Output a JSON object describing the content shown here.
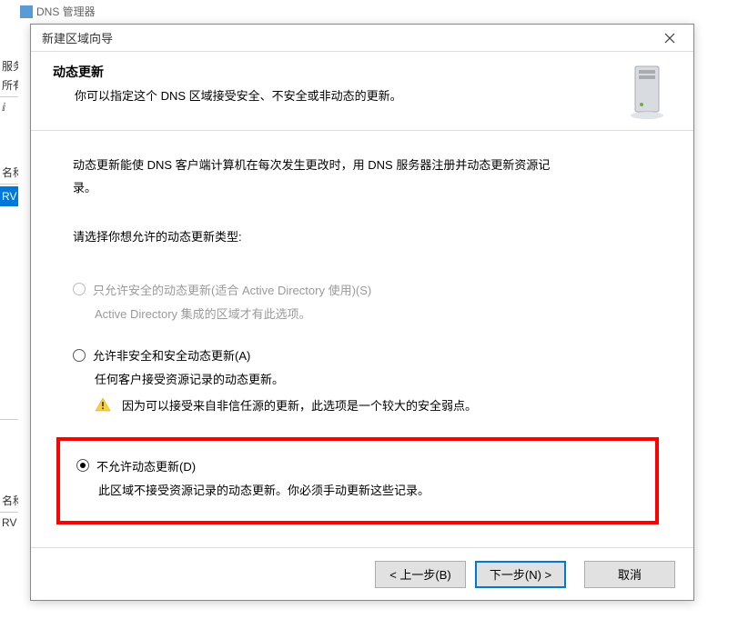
{
  "background": {
    "window_title": "DNS 管理器",
    "sidebar": {
      "item1": "服务",
      "item2": "所有",
      "itemE": "ⅈ",
      "itemName": "名称",
      "itemActive": "RV",
      "itemBottom1": "名称",
      "itemBottom2": "RV"
    }
  },
  "dialog": {
    "title": "新建区域向导",
    "close": "✕",
    "header": {
      "heading": "动态更新",
      "subtext": "你可以指定这个 DNS 区域接受安全、不安全或非动态的更新。"
    },
    "intro1": "动态更新能使 DNS 客户端计算机在每次发生更改时，用 DNS 服务器注册并动态更新资源记",
    "intro2": "录。",
    "instruction": "请选择你想允许的动态更新类型:",
    "options": {
      "opt1": {
        "label": "只允许安全的动态更新(适合 Active Directory 使用)(S)",
        "desc": "Active Directory 集成的区域才有此选项。"
      },
      "opt2": {
        "label": "允许非安全和安全动态更新(A)",
        "desc": "任何客户接受资源记录的动态更新。",
        "warning": "因为可以接受来自非信任源的更新，此选项是一个较大的安全弱点。"
      },
      "opt3": {
        "label": "不允许动态更新(D)",
        "desc": "此区域不接受资源记录的动态更新。你必须手动更新这些记录。"
      }
    },
    "buttons": {
      "back": "< 上一步(B)",
      "next": "下一步(N) >",
      "cancel": "取消"
    }
  }
}
